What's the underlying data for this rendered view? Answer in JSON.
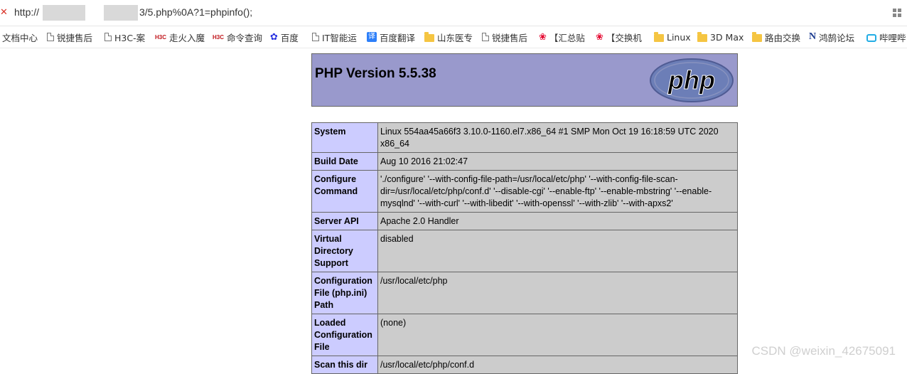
{
  "browser": {
    "url_scheme": "http://",
    "url_tail": "3/5.php%0A?1=phpinfo();",
    "security_mark": "✕"
  },
  "bookmarks": [
    {
      "label": "文档中心",
      "icon": "none"
    },
    {
      "label": "锐捷售后",
      "icon": "page-icon"
    },
    {
      "label": "H3C-案",
      "icon": "page-icon"
    },
    {
      "label": "走火入魔",
      "icon": "h3c-icon"
    },
    {
      "label": "命令查询",
      "icon": "h3c-icon"
    },
    {
      "label": "百度",
      "icon": "baidu-icon"
    },
    {
      "label": "IT智能运",
      "icon": "page-icon"
    },
    {
      "label": "百度翻译",
      "icon": "translate-icon"
    },
    {
      "label": "山东医专",
      "icon": "folder-icon"
    },
    {
      "label": "锐捷售后",
      "icon": "page-icon"
    },
    {
      "label": "【汇总贴",
      "icon": "huawei-icon"
    },
    {
      "label": "【交换机",
      "icon": "huawei-icon"
    },
    {
      "label": "Linux",
      "icon": "folder-icon"
    },
    {
      "label": "3D Max",
      "icon": "folder-icon"
    },
    {
      "label": "路由交换",
      "icon": "folder-icon"
    },
    {
      "label": "鸿鹄论坛",
      "icon": "n-icon"
    },
    {
      "label": "哔哩哔",
      "icon": "bilibili-icon"
    }
  ],
  "php": {
    "title": "PHP Version 5.5.38",
    "logo_text": "php",
    "rows": [
      {
        "label": "System",
        "value": "Linux 554aa45a66f3 3.10.0-1160.el7.x86_64 #1 SMP Mon Oct 19 16:18:59 UTC 2020 x86_64"
      },
      {
        "label": "Build Date",
        "value": "Aug 10 2016 21:02:47"
      },
      {
        "label": "Configure Command",
        "value": "'./configure' '--with-config-file-path=/usr/local/etc/php' '--with-config-file-scan-dir=/usr/local/etc/php/conf.d' '--disable-cgi' '--enable-ftp' '--enable-mbstring' '--enable-mysqlnd' '--with-curl' '--with-libedit' '--with-openssl' '--with-zlib' '--with-apxs2'"
      },
      {
        "label": "Server API",
        "value": "Apache 2.0 Handler"
      },
      {
        "label": "Virtual Directory Support",
        "value": "disabled"
      },
      {
        "label": "Configuration File (php.ini) Path",
        "value": "/usr/local/etc/php"
      },
      {
        "label": "Loaded Configuration File",
        "value": "(none)"
      },
      {
        "label": "Scan this dir",
        "value": "/usr/local/etc/php/conf.d"
      }
    ]
  },
  "watermark": "CSDN @weixin_42675091",
  "colors": {
    "header_bg": "#9999cc",
    "label_bg": "#ccccff",
    "value_bg": "#cccccc"
  }
}
